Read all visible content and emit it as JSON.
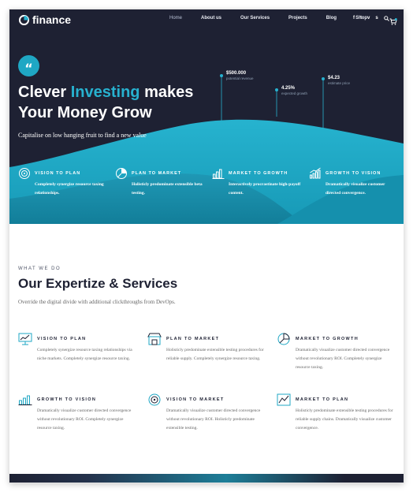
{
  "brand": {
    "name": "finance",
    "accent": "#27b1cf",
    "dark": "#1e2133"
  },
  "nav": {
    "items": [
      "Home",
      "About us",
      "Our Services",
      "Projects",
      "Blog",
      "Shop"
    ],
    "social": [
      "f",
      "t",
      "v",
      "s"
    ],
    "icons": [
      "facebook-icon",
      "twitter-icon",
      "vimeo-icon",
      "skype-icon",
      "search-icon",
      "cart-icon"
    ],
    "cart_count": "0"
  },
  "hero": {
    "quote_icon": "quote-icon",
    "title_pre": "Clever ",
    "title_accent": "Investing",
    "title_post": " makes",
    "title_line2": "Your Money Grow",
    "subtitle": "Capitalise on low hanging fruit to find a new value",
    "stats": [
      {
        "value": "$500.000",
        "label": "potential revenue"
      },
      {
        "value": "4.25%",
        "label": "expected growth"
      },
      {
        "value": "$4.23",
        "label": "estimate price"
      }
    ],
    "features": [
      {
        "icon": "target-icon",
        "title": "VISION TO PLAN",
        "desc": "Completely synergize resource taxing relationships."
      },
      {
        "icon": "pie-chart-icon",
        "title": "PLAN TO MARKET",
        "desc": "Holisticly predominate extensible beta testing."
      },
      {
        "icon": "bar-chart-icon",
        "title": "MARKET TO GROWTH",
        "desc": "Interactively procrastinate high-payoff content."
      },
      {
        "icon": "growth-chart-icon",
        "title": "GROWTH TO VISION",
        "desc": "Dramatically visualize customer directed convergence."
      }
    ]
  },
  "services": {
    "kicker": "WHAT WE DO",
    "title": "Our Expertize & Services",
    "subtitle": "Override the digital divide with additional clickthroughs from DevOps.",
    "items": [
      {
        "icon": "presentation-chart-icon",
        "title": "VISION TO PLAN",
        "desc": "Completely synergize resource taxing relationships via niche markets. Completely synergize resource taxing."
      },
      {
        "icon": "store-icon",
        "title": "PLAN TO MARKET",
        "desc": "Holisticly predominate extensible testing procedures for reliable supply. Completely synergize resource taxing."
      },
      {
        "icon": "pie-chart-icon",
        "title": "MARKET TO GROWTH",
        "desc": "Dramatically visualize customer directed convergence without revolutionary ROI. Completely synergize resource taxing."
      },
      {
        "icon": "bar-chart-icon",
        "title": "GROWTH TO VISION",
        "desc": "Dramatically visualize customer directed convergence without revolutionary ROI. Completely synergize resource taxing."
      },
      {
        "icon": "target-icon",
        "title": "VISION TO MARKET",
        "desc": "Dramatically visualize customer directed convergence without revolutionary ROI. Holisticly predominate extensible testing."
      },
      {
        "icon": "trend-line-icon",
        "title": "MARKET TO PLAN",
        "desc": "Holisticly predominate extensible testing procedures for reliable supply chains. Dramatically visualize customer convergence."
      }
    ]
  }
}
